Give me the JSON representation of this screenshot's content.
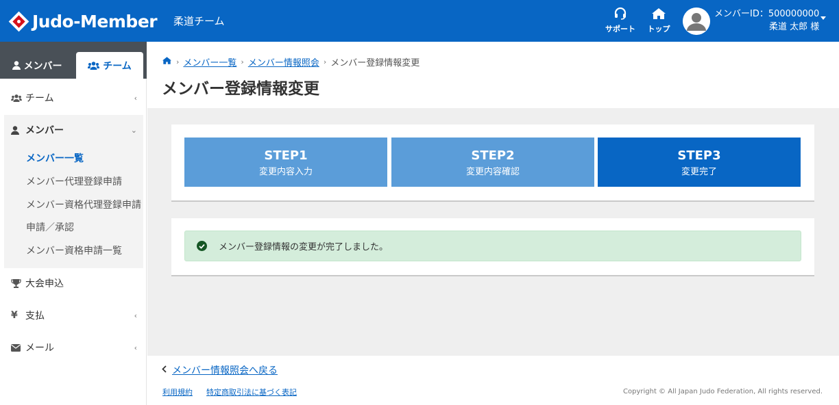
{
  "header": {
    "logo_text": "Judo-Member",
    "team_name": "柔道チーム",
    "support_label": "サポート",
    "top_label": "トップ",
    "member_id": "メンバーID：500000000",
    "user_name": "柔道 太郎 様",
    "brand_color": "#0866c4"
  },
  "sidebar": {
    "tabs": [
      {
        "label": "メンバー",
        "icon": "user-icon"
      },
      {
        "label": "チーム",
        "icon": "users-icon",
        "active": true
      }
    ],
    "items": [
      {
        "label": "チーム",
        "icon": "users-icon"
      },
      {
        "label": "メンバー",
        "icon": "user-icon",
        "expanded": true
      },
      {
        "label": "大会申込",
        "icon": "trophy-icon"
      },
      {
        "label": "支払",
        "icon": "yen-icon"
      },
      {
        "label": "メール",
        "icon": "envelope-icon"
      }
    ],
    "member_sub": [
      {
        "label": "メンバー一覧",
        "active": true
      },
      {
        "label": "メンバー代理登録申請"
      },
      {
        "label": "メンバー資格代理登録申請"
      },
      {
        "label": "申請／承認"
      },
      {
        "label": "メンバー資格申請一覧"
      }
    ]
  },
  "breadcrumb": {
    "items": [
      "メンバー一覧",
      "メンバー情報照会"
    ],
    "current": "メンバー登録情報変更"
  },
  "page_title": "メンバー登録情報変更",
  "steps": [
    {
      "title": "STEP1",
      "sub": "変更内容入力"
    },
    {
      "title": "STEP2",
      "sub": "変更内容確認"
    },
    {
      "title": "STEP3",
      "sub": "変更完了",
      "active": true
    }
  ],
  "alert": {
    "message": "メンバー登録情報の変更が完了しました。"
  },
  "footer": {
    "back_link": "メンバー情報照会へ戻る",
    "terms": "利用規約",
    "law": "特定商取引法に基づく表記",
    "copyright": "Copyright © All Japan Judo Federation, All rights reserved."
  }
}
